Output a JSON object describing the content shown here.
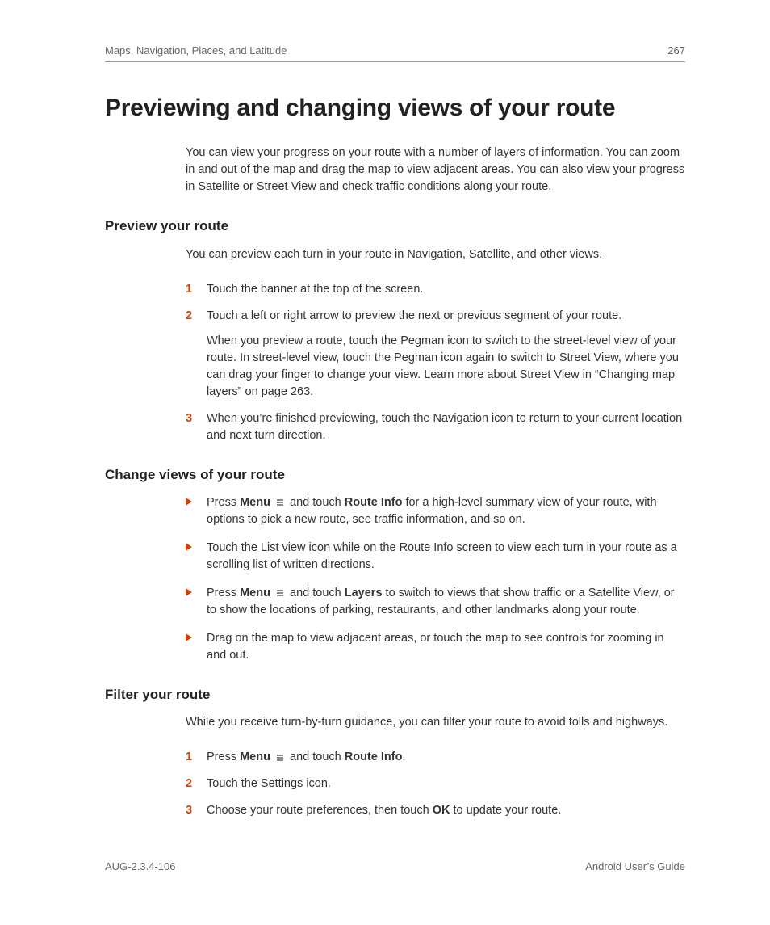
{
  "header": {
    "breadcrumb": "Maps, Navigation, Places, and Latitude",
    "page_number": "267"
  },
  "title": "Previewing and changing views of your route",
  "intro": "You can view your progress on your route with a number of layers of information. You can zoom in and out of the map and drag the map to view adjacent areas. You can also view your progress in Satellite or Street View and check traffic conditions along your route.",
  "section1": {
    "heading": "Preview your route",
    "lead": "You can preview each turn in your route in Navigation, Satellite, and other views.",
    "steps": {
      "s1": "Touch the banner at the top of the screen.",
      "s2": "Touch a left or right arrow to preview the next or previous segment of your route.",
      "s2_extra": "When you preview a route, touch the Pegman icon to switch to the street-level view of your route. In street-level view, touch the Pegman icon again to switch to Street View, where you can drag your finger to change your view. Learn more about Street View in “Changing map layers” on page 263.",
      "s3": "When you’re finished previewing, touch the Navigation icon to return to your current location and next turn direction."
    }
  },
  "section2": {
    "heading": "Change views of your route",
    "b1": {
      "pre": "Press ",
      "menu": "Menu",
      "mid": " and touch ",
      "routeinfo": "Route Info",
      "post": " for a high-level summary view of your route, with options to pick a new route, see traffic information, and so on."
    },
    "b2": "Touch the List view icon while on the Route Info screen to view each turn in your route as a scrolling list of written directions.",
    "b3": {
      "pre": "Press ",
      "menu": "Menu",
      "mid": " and touch ",
      "layers": "Layers",
      "post": " to switch to views that show traffic or a Satellite View, or to show the locations of parking, restaurants, and other landmarks along your route."
    },
    "b4": "Drag on the map to view adjacent areas, or touch the map to see controls for zooming in and out."
  },
  "section3": {
    "heading": "Filter your route",
    "lead": "While you receive turn-by-turn guidance, you can filter your route to avoid tolls and highways.",
    "s1": {
      "pre": "Press ",
      "menu": "Menu",
      "mid": " and touch ",
      "routeinfo": "Route Info",
      "post": "."
    },
    "s2": "Touch the Settings icon.",
    "s3": {
      "pre": "Choose your route preferences, then touch ",
      "ok": "OK",
      "post": " to update your route."
    }
  },
  "footer": {
    "left": "AUG-2.3.4-106",
    "right": "Android User’s Guide"
  },
  "nums": {
    "n1": "1",
    "n2": "2",
    "n3": "3"
  }
}
